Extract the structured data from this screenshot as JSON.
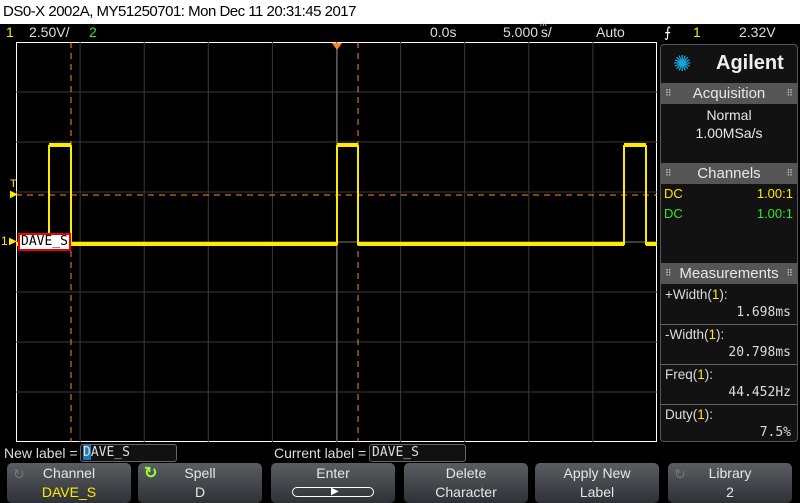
{
  "title": "DS0-X 2002A, MY51250701: Mon Dec 11 20:31:45 2017",
  "status": {
    "ch1": "1",
    "ch1_scale": "2.50V/",
    "ch2": "2",
    "time_delay": "0.0s",
    "time_scale": "5.000 s/",
    "time_scale_prefix": "m",
    "trigger_mode": "Auto",
    "trigger_edge_icon": "rising-edge-icon",
    "trigger_source": "1",
    "trigger_level": "2.32V"
  },
  "colors": {
    "ch1": "#ffeb00",
    "ch2": "#2fe62f",
    "cursor": "#ff8c1a",
    "brand": "#1aa3d9"
  },
  "side": {
    "brand": "Agilent",
    "acquisition": {
      "header": "Acquisition",
      "mode": "Normal",
      "rate": "1.00MSa/s"
    },
    "channels": {
      "header": "Channels",
      "rows": [
        {
          "coupling": "DC",
          "probe": "1.00:1"
        },
        {
          "coupling": "DC",
          "probe": "1.00:1"
        }
      ]
    },
    "measurements": {
      "header": "Measurements",
      "items": [
        {
          "name": "+Width(",
          "src": "1",
          "close": "):",
          "value": "1.698ms"
        },
        {
          "name": "-Width(",
          "src": "1",
          "close": "):",
          "value": "20.798ms"
        },
        {
          "name": "Freq(",
          "src": "1",
          "close": "):",
          "value": "44.452Hz"
        },
        {
          "name": "Duty(",
          "src": "1",
          "close": "):",
          "value": "7.5%"
        }
      ]
    }
  },
  "plot": {
    "channel_label": "DAVE_S",
    "ch1_marker": "1",
    "trigger_marker": "T"
  },
  "labelbar": {
    "new_label_text": "New label =",
    "new_label_cursor": "D",
    "new_label_rest": "AVE_S",
    "current_label_text": "Current label =",
    "current_label": "DAVE_S"
  },
  "softkeys": [
    {
      "top": "Channel",
      "bottom": "DAVE_S"
    },
    {
      "top": "Spell",
      "bottom": "D"
    },
    {
      "top": "Enter",
      "bottom": ""
    },
    {
      "top": "Delete",
      "bottom": "Character"
    },
    {
      "top": "Apply New",
      "bottom": "Label"
    },
    {
      "top": "Library",
      "bottom": "2"
    }
  ]
}
